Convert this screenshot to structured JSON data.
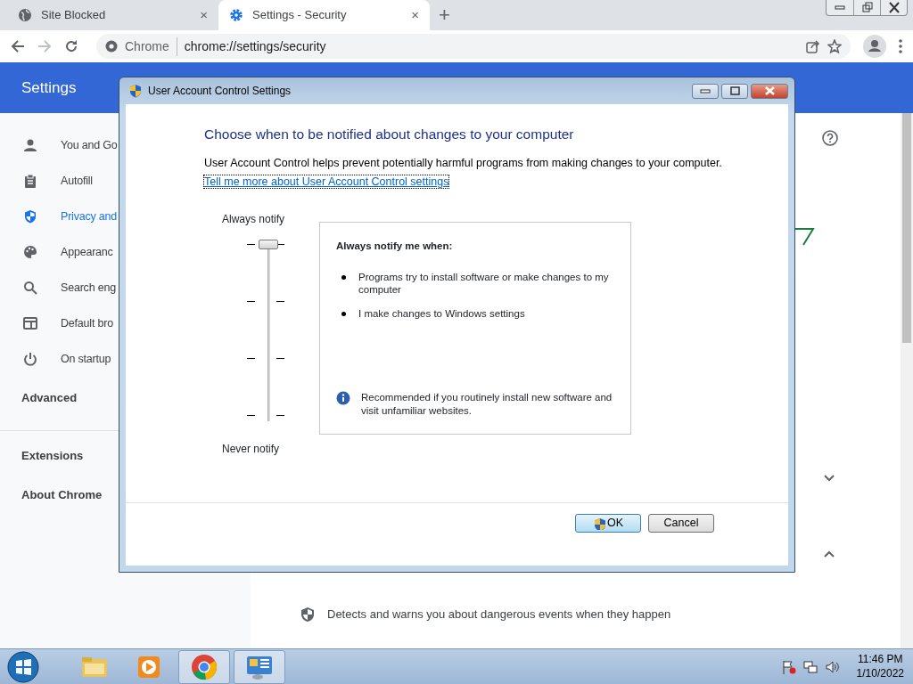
{
  "browser": {
    "tabs": [
      {
        "title": "Site Blocked",
        "close": "×",
        "selected": false
      },
      {
        "title": "Settings - Security",
        "close": "×",
        "selected": true
      }
    ],
    "new_tab": "+",
    "address": {
      "origin": "Chrome",
      "url": "chrome://settings/security"
    }
  },
  "settings": {
    "title": "Settings",
    "menu": [
      {
        "label": "You and Go",
        "selected": false
      },
      {
        "label": "Autofill",
        "selected": false
      },
      {
        "label": "Privacy and",
        "selected": true
      },
      {
        "label": "Appearanc",
        "selected": false
      },
      {
        "label": "Search eng",
        "selected": false
      },
      {
        "label": "Default bro",
        "selected": false
      },
      {
        "label": "On startup",
        "selected": false
      }
    ],
    "advanced": "Advanced",
    "links": [
      "Extensions",
      "About Chrome"
    ],
    "feature_text": "Detects and warns you about dangerous events when they happen"
  },
  "dialog": {
    "title": "User Account Control Settings",
    "heading": "Choose when to be notified about changes to your computer",
    "description": "User Account Control helps prevent potentially harmful programs from making changes to your computer.",
    "link": "Tell me more about User Account Control settings",
    "slider": {
      "top_label": "Always notify",
      "bottom_label": "Never notify",
      "level": 1
    },
    "info": {
      "title": "Always notify me when:",
      "bullets": [
        "Programs try to install software or make changes to my computer",
        "I make changes to Windows settings"
      ],
      "note": "Recommended if you routinely install new software and visit unfamiliar websites."
    },
    "buttons": [
      {
        "label": "OK",
        "kind": "primary"
      },
      {
        "label": "Cancel",
        "kind": "default"
      }
    ]
  },
  "taskbar": {
    "apps": [
      {
        "active": false
      },
      {
        "active": false
      },
      {
        "active": true
      },
      {
        "active": true
      }
    ],
    "time": "11:46 PM",
    "date": "1/10/2022"
  }
}
